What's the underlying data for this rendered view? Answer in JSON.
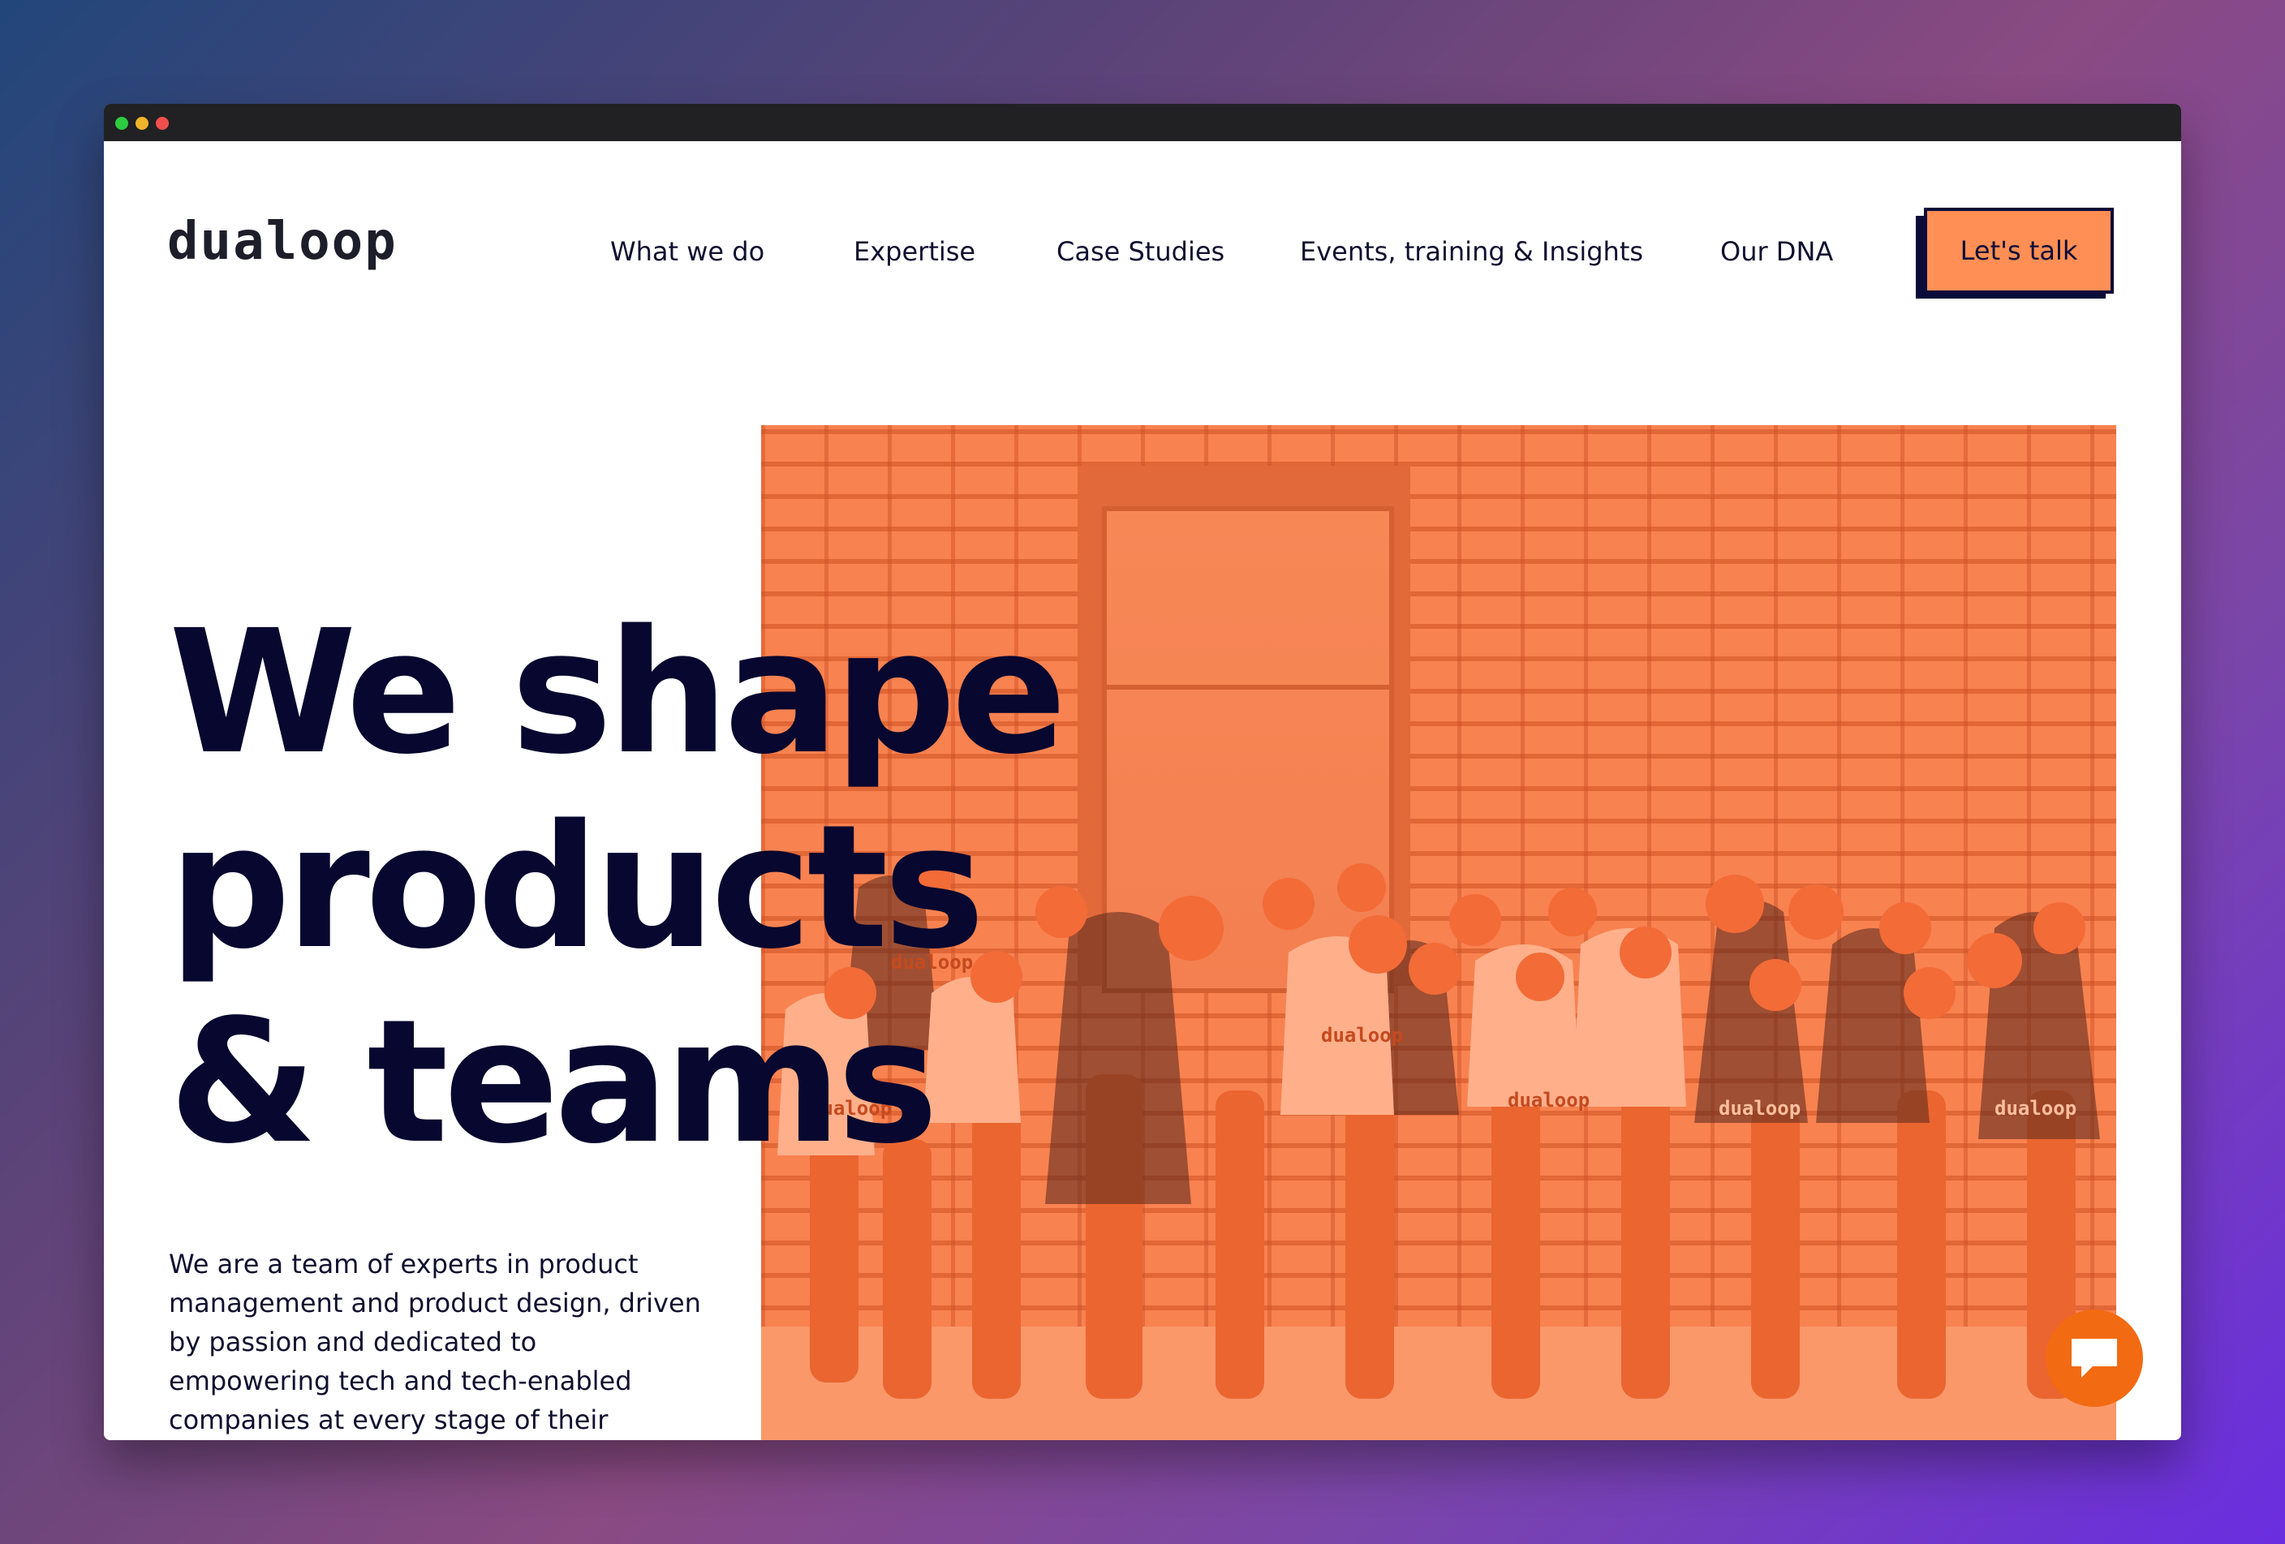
{
  "brand": {
    "logo_text": "dualoop"
  },
  "nav": {
    "items": [
      {
        "label": "What we do"
      },
      {
        "label": "Expertise"
      },
      {
        "label": "Case Studies"
      },
      {
        "label": "Events, training & Insights"
      },
      {
        "label": "Our DNA"
      }
    ],
    "cta_label": "Let's talk"
  },
  "hero": {
    "headline_lines": [
      "We shape",
      "products",
      "& teams"
    ],
    "description": "We are a team of experts in product management and product design, driven by passion and dedicated to empowering tech and tech-enabled companies at every stage of their journey.",
    "shirt_text": "dualoop"
  },
  "icons": {
    "window_controls": [
      "green-dot",
      "yellow-dot",
      "red-dot"
    ],
    "chat": "chat-bubble-icon"
  },
  "colors": {
    "accent": "#ff8f54",
    "navy": "#07072f",
    "photo_tint": "#fc7a45",
    "chat_button": "#f26a12"
  }
}
